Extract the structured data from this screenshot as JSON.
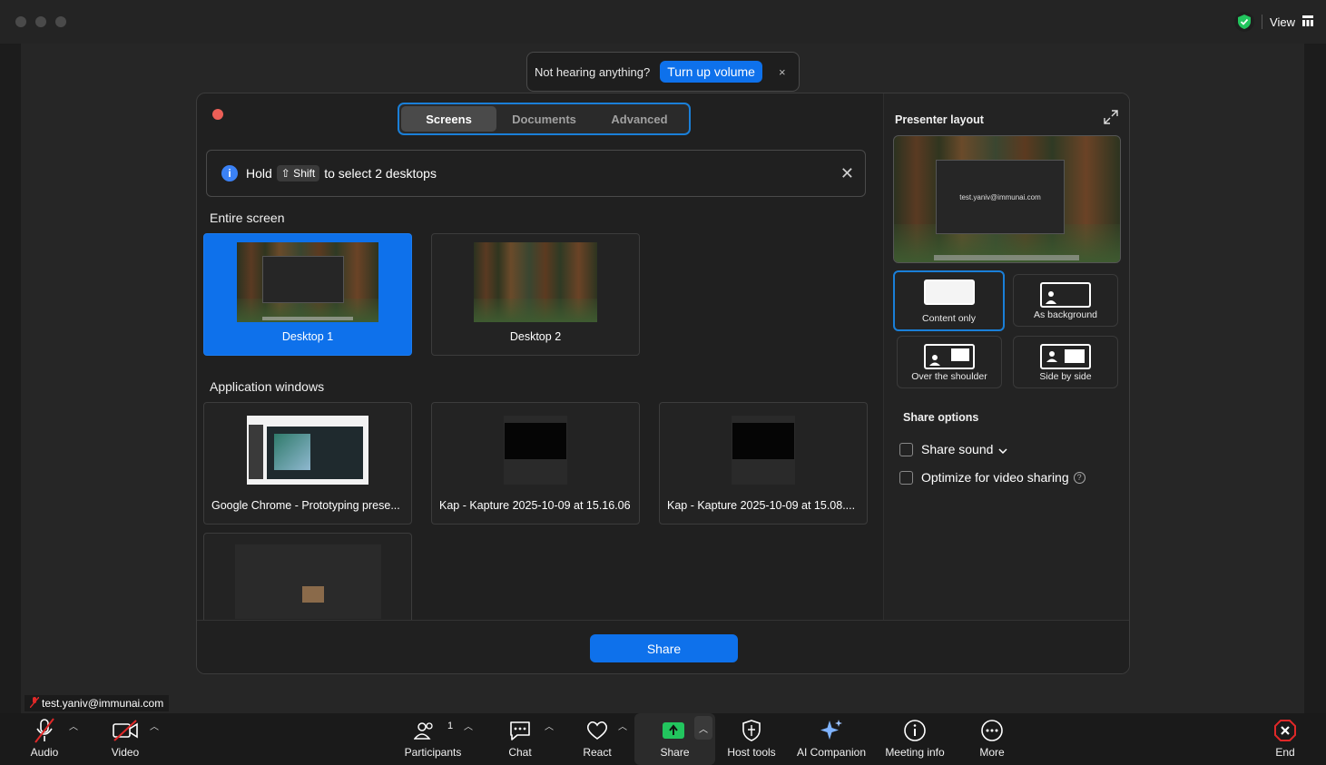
{
  "titlebar": {
    "view_label": "View"
  },
  "toast": {
    "message": "Not hearing anything?",
    "action": "Turn up volume",
    "close": "×"
  },
  "dialog": {
    "tabs": [
      {
        "label": "Screens",
        "active": true
      },
      {
        "label": "Documents",
        "active": false
      },
      {
        "label": "Advanced",
        "active": false
      }
    ],
    "banner": {
      "prefix": "Hold",
      "key": "⇧ Shift",
      "suffix": "to select 2 desktops",
      "close": "✕",
      "info": "i"
    },
    "entire_screen_title": "Entire screen",
    "desktops": [
      {
        "label": "Desktop 1",
        "selected": true
      },
      {
        "label": "Desktop 2",
        "selected": false
      }
    ],
    "app_windows_title": "Application windows",
    "apps": [
      {
        "label": "Google Chrome - Prototyping prese..."
      },
      {
        "label": "Kap - Kapture 2025-10-09 at 15.16.06"
      },
      {
        "label": "Kap - Kapture 2025-10-09 at 15.08...."
      },
      {
        "label": ""
      }
    ],
    "presenter_layout_title": "Presenter layout",
    "preview_text": "test.yaniv@immunai.com",
    "layouts": [
      {
        "label": "Content only",
        "active": true
      },
      {
        "label": "As background",
        "active": false
      },
      {
        "label": "Over the shoulder",
        "active": false
      },
      {
        "label": "Side by side",
        "active": false
      }
    ],
    "share_options_title": "Share options",
    "share_sound": "Share sound",
    "optimize_video": "Optimize for video sharing",
    "share_button": "Share"
  },
  "user_tag": "test.yaniv@immunai.com",
  "toolbar": {
    "audio": "Audio",
    "video": "Video",
    "participants": "Participants",
    "participants_count": "1",
    "chat": "Chat",
    "react": "React",
    "share": "Share",
    "host_tools": "Host tools",
    "ai_companion": "AI Companion",
    "meeting_info": "Meeting info",
    "more": "More",
    "end": "End"
  },
  "colors": {
    "accent": "#0e71eb",
    "end": "#e02828",
    "share_green": "#22c55e"
  }
}
